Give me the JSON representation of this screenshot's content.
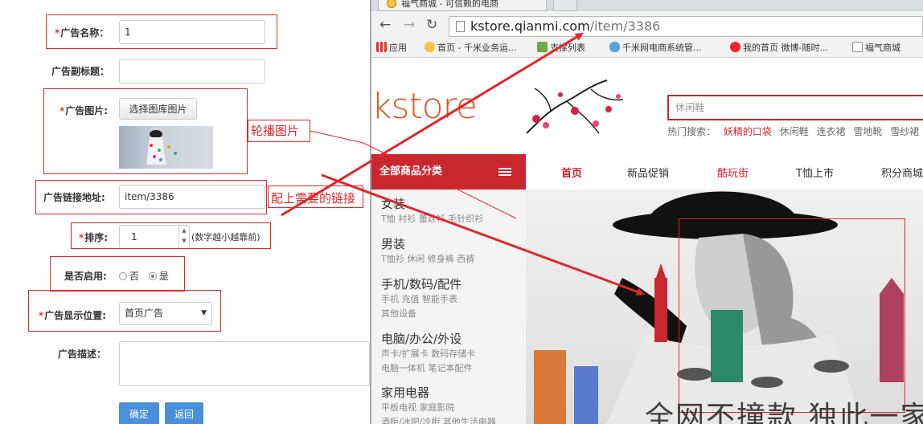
{
  "form": {
    "ad_name_label": "广告名称：",
    "ad_name_value": "1",
    "ad_subtitle_label": "广告副标题：",
    "ad_subtitle_value": "",
    "ad_image_label": "广告图片:",
    "choose_image_button": "选择图库图片",
    "ad_link_label": "广告链接地址:",
    "ad_link_value": "item/3386",
    "sort_label": "排序:",
    "sort_value": "1",
    "sort_hint": "(数字越小越靠前)",
    "enabled_label": "是否启用:",
    "enabled_options": [
      "否",
      "是"
    ],
    "enabled_selected": "是",
    "position_label": "广告显示位置:",
    "position_value": "首页广告",
    "description_label": "广告描述：",
    "description_value": "",
    "confirm_button": "确定",
    "back_button": "返回",
    "required_mark": "*"
  },
  "annotations": {
    "carousel_image_note": "轮播图片",
    "link_note": "配上需要的链接",
    "annotation_color": "#e0262c"
  },
  "browser": {
    "tab_title": "福气商城 - 可信赖的电商",
    "url_host": "kstore.qianmi.com",
    "url_path": "/item/3386",
    "bookmarks": [
      {
        "label": "应用",
        "icon": "apps-icon"
      },
      {
        "label": "首页 - 千米业务运...",
        "icon": "smiley-icon"
      },
      {
        "label": "支撑列表",
        "icon": "leaf-icon"
      },
      {
        "label": "千米网电商系统管...",
        "icon": "cloud-icon"
      },
      {
        "label": "我的首页 微博-随时...",
        "icon": "weibo-icon"
      },
      {
        "label": "福气商城",
        "icon": "page-icon"
      }
    ]
  },
  "store": {
    "logo": "kstore",
    "search_placeholder": "休闲鞋",
    "hot_search_label": "热门搜索：",
    "hot_searches": [
      "妖精的口袋",
      "休闲鞋",
      "连衣裙",
      "雪地靴",
      "雪纱裙"
    ],
    "all_categories": "全部商品分类",
    "nav": [
      "首页",
      "新品促销",
      "酷玩街",
      "T恤上市",
      "积分商城"
    ],
    "categories": [
      {
        "title": "女装",
        "subs": [
          "T恤 衬衫 蕾丝衫 毛针织衫"
        ]
      },
      {
        "title": "男装",
        "subs": [
          "T恤衫 休闲 修身裤 西裤"
        ]
      },
      {
        "title": "手机/数码/配件",
        "subs": [
          "手机 充值 智能手表",
          "其他设备"
        ]
      },
      {
        "title": "电脑/办公/外设",
        "subs": [
          "声卡/扩展卡 数码存储卡",
          "电脑一体机 笔记本配件"
        ]
      },
      {
        "title": "家用电器",
        "subs": [
          "平板电视 家庭影院",
          "酒柜/冰吧/冷柜 其他生活电器"
        ]
      }
    ],
    "banner_slogan": "全网不撞款 独此一家",
    "accent_color": "#c9262e"
  }
}
